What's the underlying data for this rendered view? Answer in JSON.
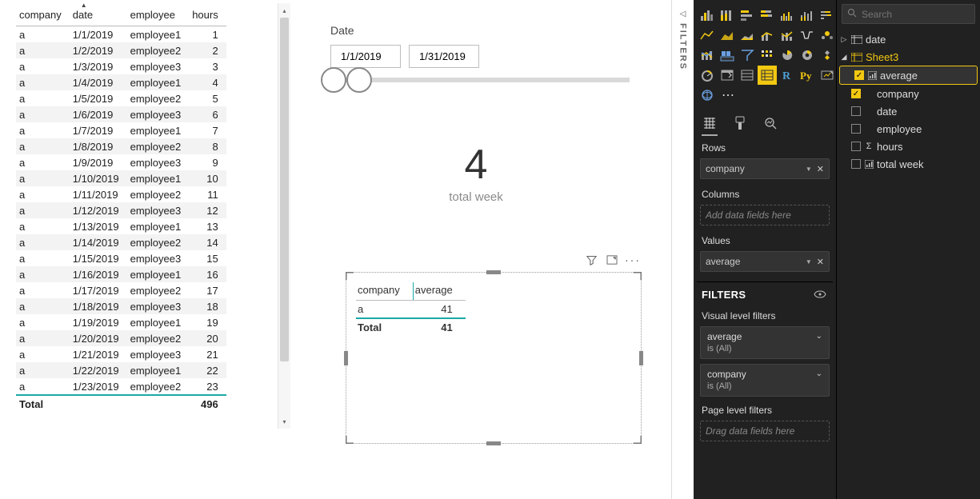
{
  "left_table": {
    "columns": [
      "company",
      "date",
      "employee",
      "hours"
    ],
    "sort_column": "date",
    "rows": [
      [
        "a",
        "1/1/2019",
        "employee1",
        "1"
      ],
      [
        "a",
        "1/2/2019",
        "employee2",
        "2"
      ],
      [
        "a",
        "1/3/2019",
        "employee3",
        "3"
      ],
      [
        "a",
        "1/4/2019",
        "employee1",
        "4"
      ],
      [
        "a",
        "1/5/2019",
        "employee2",
        "5"
      ],
      [
        "a",
        "1/6/2019",
        "employee3",
        "6"
      ],
      [
        "a",
        "1/7/2019",
        "employee1",
        "7"
      ],
      [
        "a",
        "1/8/2019",
        "employee2",
        "8"
      ],
      [
        "a",
        "1/9/2019",
        "employee3",
        "9"
      ],
      [
        "a",
        "1/10/2019",
        "employee1",
        "10"
      ],
      [
        "a",
        "1/11/2019",
        "employee2",
        "11"
      ],
      [
        "a",
        "1/12/2019",
        "employee3",
        "12"
      ],
      [
        "a",
        "1/13/2019",
        "employee1",
        "13"
      ],
      [
        "a",
        "1/14/2019",
        "employee2",
        "14"
      ],
      [
        "a",
        "1/15/2019",
        "employee3",
        "15"
      ],
      [
        "a",
        "1/16/2019",
        "employee1",
        "16"
      ],
      [
        "a",
        "1/17/2019",
        "employee2",
        "17"
      ],
      [
        "a",
        "1/18/2019",
        "employee3",
        "18"
      ],
      [
        "a",
        "1/19/2019",
        "employee1",
        "19"
      ],
      [
        "a",
        "1/20/2019",
        "employee2",
        "20"
      ],
      [
        "a",
        "1/21/2019",
        "employee3",
        "21"
      ],
      [
        "a",
        "1/22/2019",
        "employee1",
        "22"
      ],
      [
        "a",
        "1/23/2019",
        "employee2",
        "23"
      ]
    ],
    "total_label": "Total",
    "total_value": "496"
  },
  "slicer": {
    "title": "Date",
    "from": "1/1/2019",
    "to": "1/31/2019"
  },
  "card": {
    "value": "4",
    "caption": "total week"
  },
  "matrix": {
    "columns": [
      "company",
      "average"
    ],
    "rows": [
      [
        "a",
        "41"
      ]
    ],
    "total_label": "Total",
    "total_value": "41"
  },
  "filters_tab": "FILTERS",
  "viz_pane": {
    "sections": {
      "rows_label": "Rows",
      "rows_field": "company",
      "columns_label": "Columns",
      "columns_placeholder": "Add data fields here",
      "values_label": "Values",
      "values_field": "average"
    },
    "filters_header": "FILTERS",
    "visual_filters_label": "Visual level filters",
    "filter1_name": "average",
    "filter1_val": "is (All)",
    "filter2_name": "company",
    "filter2_val": "is (All)",
    "page_filters_label": "Page level filters",
    "page_filters_placeholder": "Drag data fields here"
  },
  "fields_pane": {
    "search_placeholder": "Search",
    "tables": [
      {
        "name": "date",
        "expanded": false,
        "yellow": false
      },
      {
        "name": "Sheet3",
        "expanded": true,
        "yellow": true,
        "fields": [
          {
            "name": "average",
            "checked": true,
            "selected": true,
            "icon": "measure"
          },
          {
            "name": "company",
            "checked": true
          },
          {
            "name": "date",
            "checked": false
          },
          {
            "name": "employee",
            "checked": false
          },
          {
            "name": "hours",
            "checked": false,
            "icon": "sigma"
          },
          {
            "name": "total week",
            "checked": false,
            "icon": "measure"
          }
        ]
      }
    ]
  }
}
